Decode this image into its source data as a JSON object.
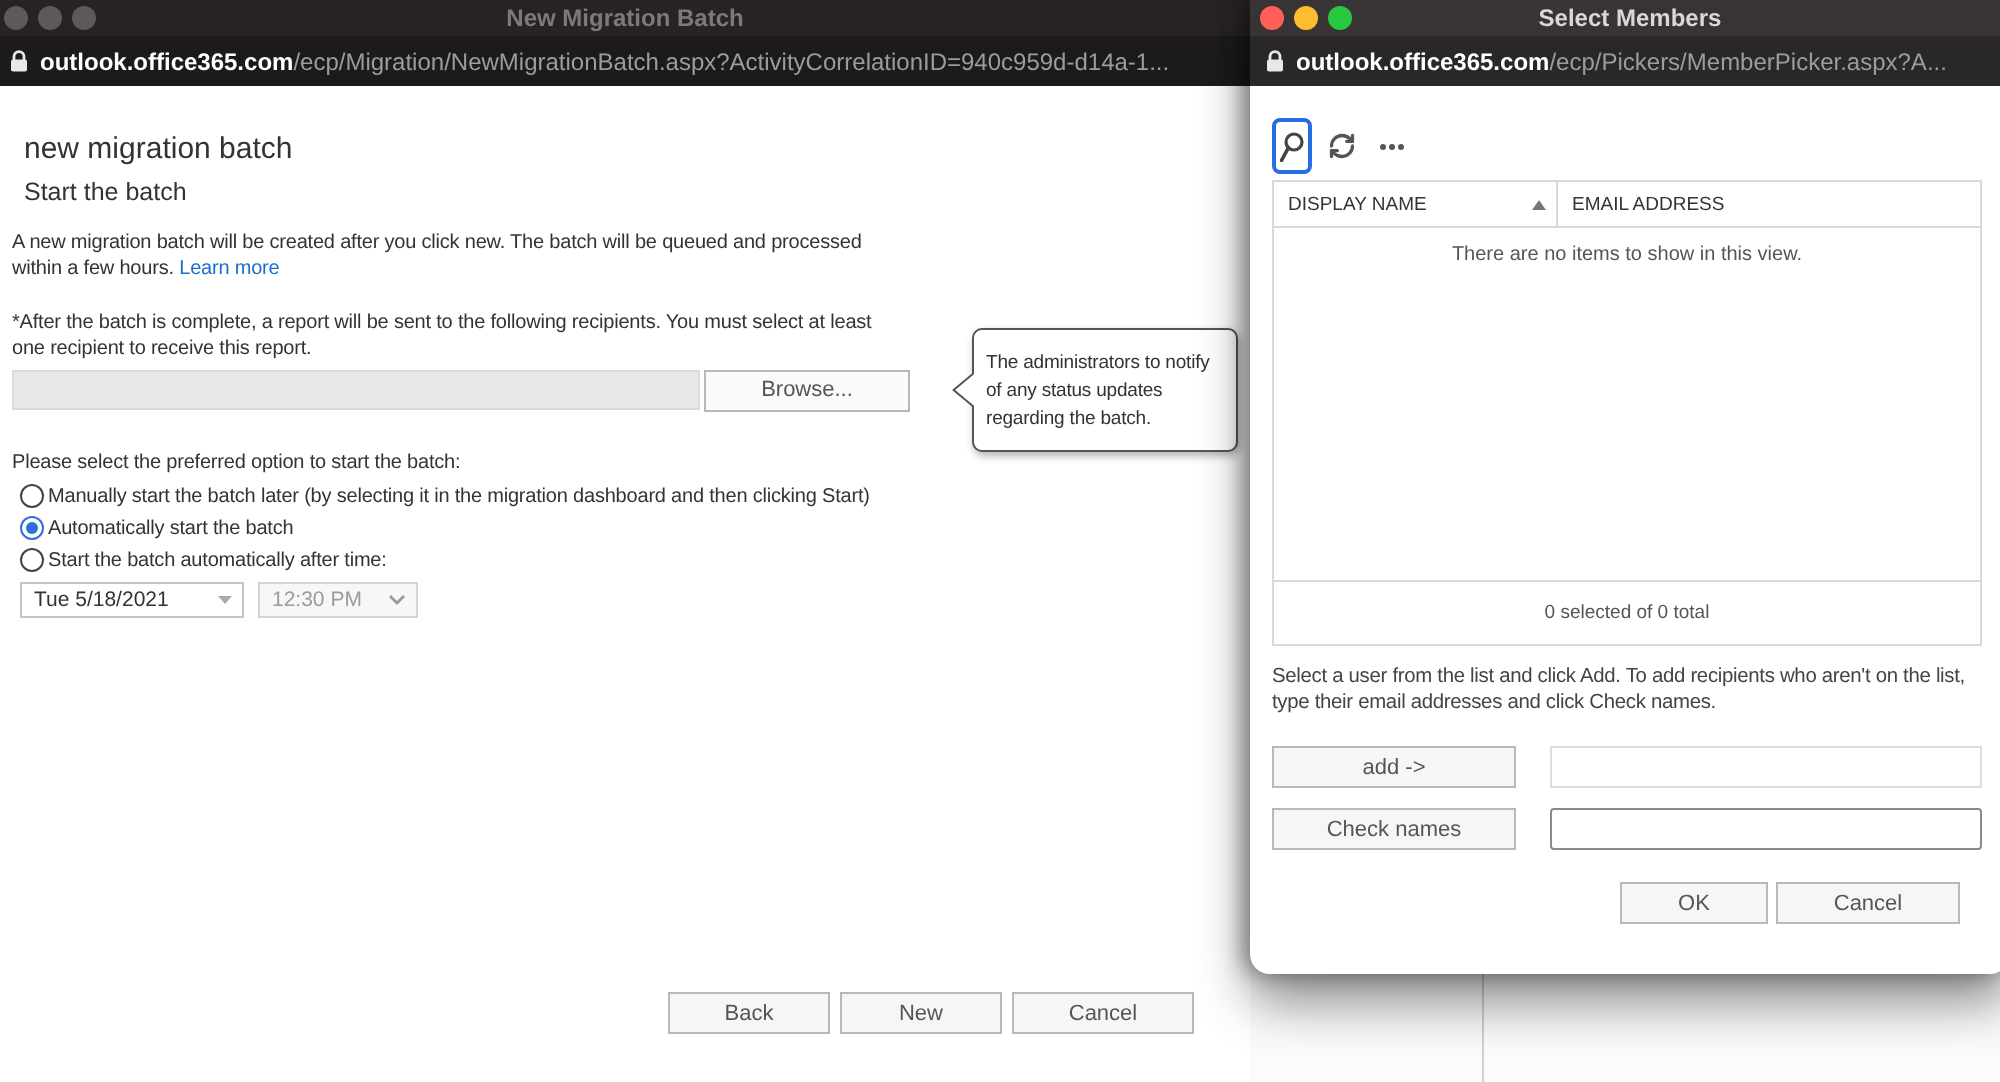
{
  "main_window": {
    "title": "New Migration Batch",
    "focused": false,
    "address": {
      "host": "outlook.office365.com",
      "path": "/ecp/Migration/NewMigrationBatch.aspx?ActivityCorrelationID=940c959d-d14a-1..."
    },
    "heading": "new migration batch",
    "subheading": "Start the batch",
    "intro": {
      "text": "A new migration batch will be created after you click new. The batch will be queued and processed within a few hours.",
      "link": "Learn more"
    },
    "recipients": {
      "label": "*After the batch is complete, a report will be sent to the following recipients. You must select at least one recipient to receive this report.",
      "browse_button": "Browse...",
      "tooltip": "The administrators to notify of any status updates regarding the batch."
    },
    "start_options": {
      "label": "Please select the preferred option to start the batch:",
      "options": [
        {
          "label": "Manually start the batch later (by selecting it in the migration dashboard and then clicking Start)",
          "selected": false
        },
        {
          "label": "Automatically start the batch",
          "selected": true
        },
        {
          "label": "Start the batch automatically after time:",
          "selected": false
        }
      ],
      "date": {
        "value": "Tue 5/18/2021",
        "disabled": false
      },
      "time": {
        "value": "12:30 PM",
        "disabled": true
      }
    },
    "buttons": [
      "Back",
      "New",
      "Cancel"
    ]
  },
  "member_picker": {
    "title": "Select Members",
    "focused": true,
    "address": {
      "host": "outlook.office365.com",
      "path": "/ecp/Pickers/MemberPicker.aspx?A..."
    },
    "toolbar": [
      {
        "kind": "search",
        "focused": true
      },
      {
        "kind": "refresh",
        "focused": false
      },
      {
        "kind": "more",
        "focused": false
      }
    ],
    "table": {
      "columns": [
        {
          "label": "DISPLAY NAME",
          "sorted": true
        },
        {
          "label": "EMAIL ADDRESS",
          "sorted": false
        }
      ],
      "empty_message": "There are no items to show in this view.",
      "footer": "0 selected of 0 total"
    },
    "instructions": "Select a user from the list and click Add. To add recipients who aren't on the list, type their email addresses and click Check names.",
    "add_button": "add ->",
    "added_field": {
      "read_only": true
    },
    "check_names_button": "Check names",
    "names_field": {
      "read_only": false
    },
    "buttons": [
      "OK",
      "Cancel"
    ]
  }
}
